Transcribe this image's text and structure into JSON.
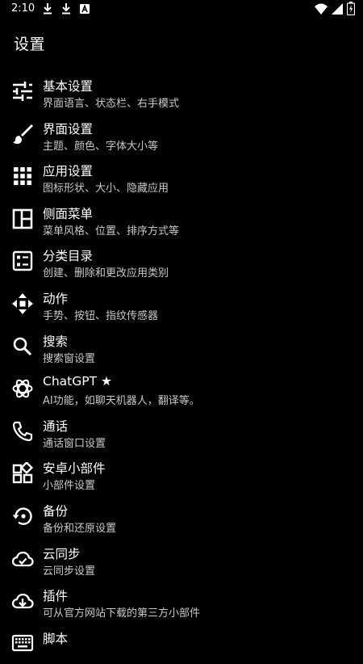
{
  "status_bar": {
    "time": "2:10",
    "notification_icons": [
      "download-icon",
      "download-icon",
      "a-badge-icon"
    ],
    "right_icons": [
      "wifi-icon",
      "signal-icon",
      "battery-icon"
    ]
  },
  "page": {
    "title": "设置"
  },
  "colors": {
    "background": "#000000",
    "text": "#ffffff",
    "subtext": "#c8c8c8"
  },
  "menu": [
    {
      "key": "basic",
      "title": "基本设置",
      "subtitle": "界面语言、状态栏、右手模式",
      "icon": "sliders-icon"
    },
    {
      "key": "interface",
      "title": "界面设置",
      "subtitle": "主题、颜色、字体大小等",
      "icon": "brush-icon"
    },
    {
      "key": "apps",
      "title": "应用设置",
      "subtitle": "图标形状、大小、隐藏应用",
      "icon": "grid-icon"
    },
    {
      "key": "side-menu",
      "title": "侧面菜单",
      "subtitle": "菜单风格、位置、排序方式等",
      "icon": "side-panel-icon"
    },
    {
      "key": "categories",
      "title": "分类目录",
      "subtitle": "创建、删除和更改应用类别",
      "icon": "category-list-icon"
    },
    {
      "key": "actions",
      "title": "动作",
      "subtitle": "手势、按钮、指纹传感器",
      "icon": "move-arrows-icon"
    },
    {
      "key": "search",
      "title": "搜索",
      "subtitle": "搜索窗设置",
      "icon": "search-icon"
    },
    {
      "key": "chatgpt",
      "title": "ChatGPT ★",
      "subtitle": "AI功能，如聊天机器人，翻译等。",
      "icon": "chatgpt-icon"
    },
    {
      "key": "calls",
      "title": "通话",
      "subtitle": "通话窗口设置",
      "icon": "phone-icon"
    },
    {
      "key": "widgets",
      "title": "安卓小部件",
      "subtitle": "小部件设置",
      "icon": "widgets-icon"
    },
    {
      "key": "backup",
      "title": "备份",
      "subtitle": "备份和还原设置",
      "icon": "backup-restore-icon"
    },
    {
      "key": "cloud-sync",
      "title": "云同步",
      "subtitle": "云同步设置",
      "icon": "cloud-sync-icon"
    },
    {
      "key": "plugins",
      "title": "插件",
      "subtitle": "可从官方网站下载的第三方小部件",
      "icon": "cloud-download-icon"
    },
    {
      "key": "scripts",
      "title": "脚本",
      "subtitle": "",
      "icon": "keyboard-icon"
    }
  ]
}
